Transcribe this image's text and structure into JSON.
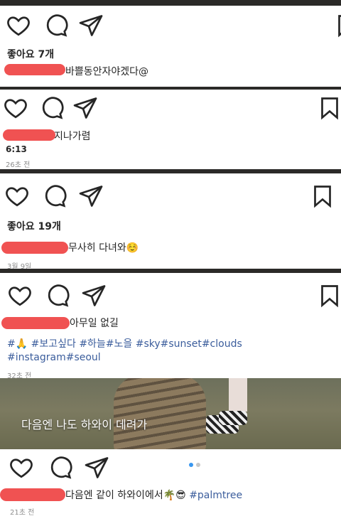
{
  "posts": [
    {
      "likes": "좋아요 7개",
      "comment": "바쁠동안자야겠다@"
    },
    {
      "comment": "지나가렴",
      "time_value": "6:13",
      "timestamp": "26초 전"
    },
    {
      "likes": "좋아요 19개",
      "comment": "무사히 다녀와☺️",
      "timestamp": "3월 9일"
    },
    {
      "comment": "아무일 없길",
      "hashtags_line1": "#🙏 #보고싶다 #하늘#노을 #sky#sunset#clouds",
      "hashtags_line2": "#instagram#seoul",
      "timestamp": "32초 전",
      "photo_caption": "다음엔 나도 하와이 데려가"
    },
    {
      "comment_text": "다음엔 같이 하와이에서🌴😎 ",
      "comment_tag": "#palmtree",
      "timestamp": "21초 전"
    }
  ],
  "colors": {
    "redaction": "#f05252",
    "hashtag": "#3b5d9c",
    "dot_active": "#3897f0",
    "dot_inactive": "#c7c7c7"
  },
  "icons": [
    "heart-icon",
    "comment-icon",
    "share-icon",
    "bookmark-icon"
  ]
}
